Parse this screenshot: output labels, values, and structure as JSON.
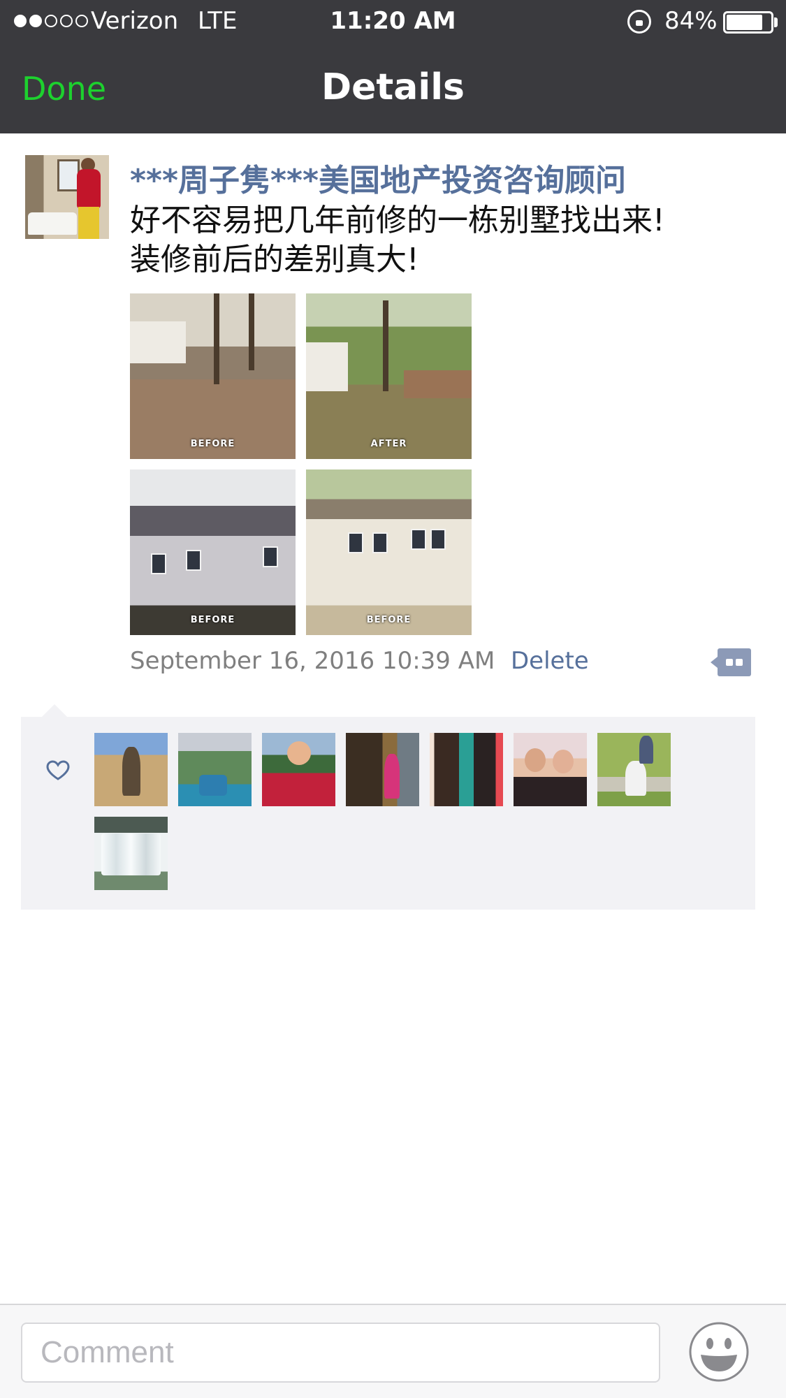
{
  "status_bar": {
    "carrier": "Verizon",
    "network": "LTE",
    "time": "11:20 AM",
    "battery_percent": "84%",
    "battery_level": 0.84,
    "signal_bars_filled": 2,
    "signal_bars_total": 5
  },
  "nav": {
    "done_label": "Done",
    "title": "Details",
    "done_color": "#1dd12e"
  },
  "post": {
    "author": "***周子隽***美国地产投资咨询顾问",
    "text_line_1": "好不容易把几年前修的一栋别墅找出来!",
    "text_line_2": "装修前后的差别真大!",
    "photos": [
      {
        "caption": "BEFORE"
      },
      {
        "caption": "AFTER"
      },
      {
        "caption": "BEFORE"
      },
      {
        "caption": "BEFORE"
      }
    ],
    "timestamp": "September 16, 2016 10:39 AM",
    "delete_label": "Delete",
    "link_color": "#56709b"
  },
  "likes": {
    "icon": "heart-icon",
    "liker_count": 8
  },
  "comment_bar": {
    "placeholder": "Comment",
    "emoji_icon": "smiley-face-icon"
  }
}
